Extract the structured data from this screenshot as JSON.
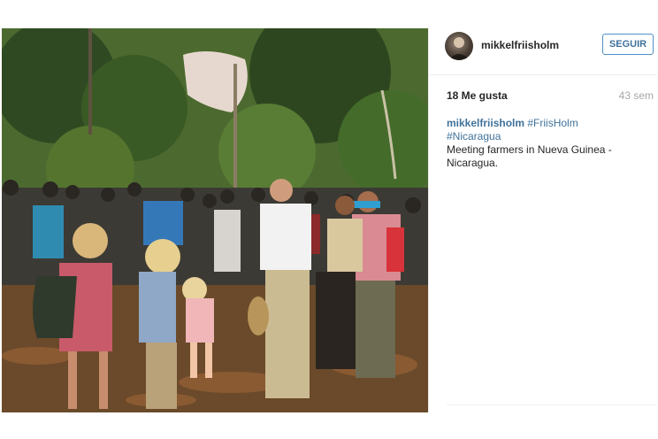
{
  "post": {
    "username": "mikkelfriisholm",
    "follow_label": "SEGUIR",
    "likes": "18 Me gusta",
    "time": "43 sem",
    "caption": {
      "user": "mikkelfriisholm",
      "tag1": "#FriisHolm",
      "tag2": "#Nicaragua",
      "text": "Meeting farmers in Nueva Guinea - Nicaragua."
    }
  }
}
